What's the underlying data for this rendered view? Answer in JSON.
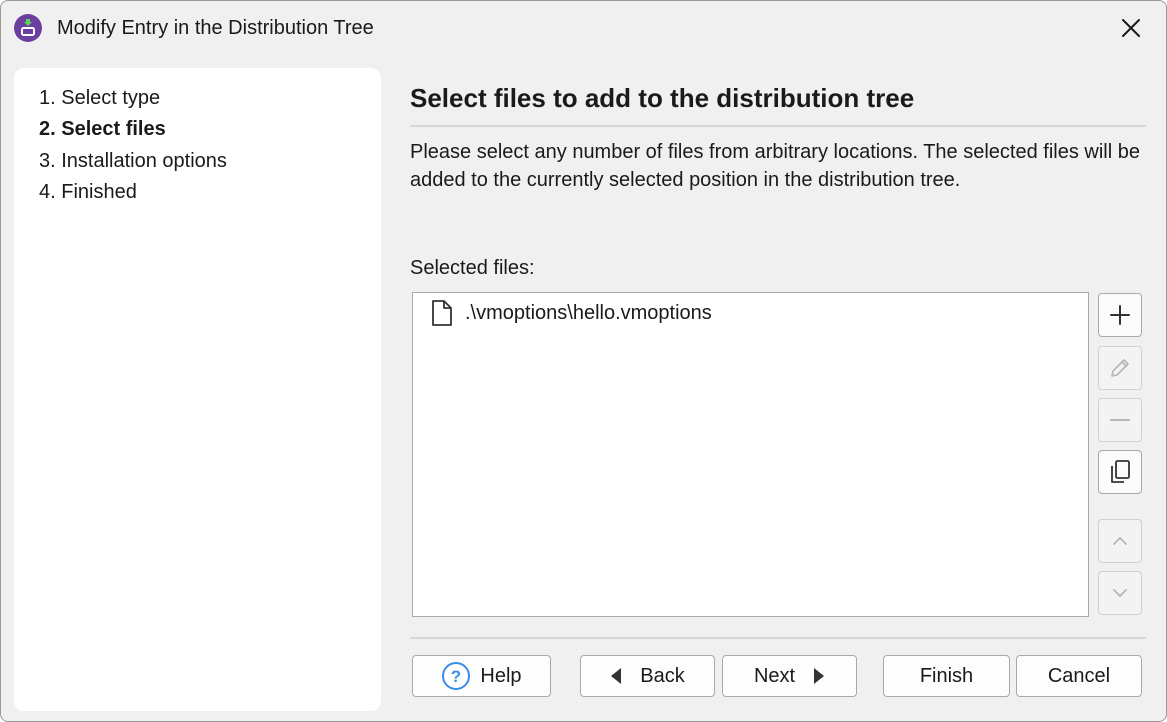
{
  "window": {
    "title": "Modify Entry in the Distribution Tree",
    "accent_color": "#6b3fa0"
  },
  "steps": [
    {
      "label": "1. Select type",
      "active": false
    },
    {
      "label": "2. Select files",
      "active": true
    },
    {
      "label": "3. Installation options",
      "active": false
    },
    {
      "label": "4. Finished",
      "active": false
    }
  ],
  "page": {
    "title": "Select files to add to the distribution tree",
    "description": "Please select any number of files from arbitrary locations. The selected files will be added to the currently selected position in the distribution tree."
  },
  "files": {
    "label": "Selected files:",
    "items": [
      {
        "name": ".\\vmoptions\\hello.vmoptions",
        "icon": "file-icon"
      }
    ]
  },
  "side_buttons": [
    {
      "name": "add-button",
      "icon": "plus-icon",
      "enabled": true
    },
    {
      "name": "edit-button",
      "icon": "pencil-icon",
      "enabled": false
    },
    {
      "name": "remove-button",
      "icon": "minus-icon",
      "enabled": false
    },
    {
      "name": "copy-button",
      "icon": "copy-icon",
      "enabled": true
    },
    {
      "name": "move-up-button",
      "icon": "chevron-up-icon",
      "enabled": false
    },
    {
      "name": "move-down-button",
      "icon": "chevron-down-icon",
      "enabled": false
    }
  ],
  "footer": {
    "help_label": "Help",
    "back_label": "Back",
    "next_label": "Next",
    "finish_label": "Finish",
    "cancel_label": "Cancel"
  }
}
